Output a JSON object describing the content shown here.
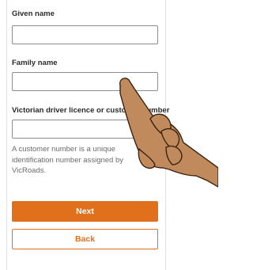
{
  "form": {
    "given_name_label": "Given name",
    "given_name_value": "",
    "family_name_label": "Family name",
    "family_name_value": "",
    "licence_label": "Victorian driver licence or customer number",
    "licence_value": "",
    "hint": "A customer number is a unique identification number assigned by VicRoads."
  },
  "actions": {
    "next_label": "Next",
    "back_label": "Back"
  },
  "colors": {
    "accent": "#e0701c",
    "hand_skin": "#c18a5c"
  },
  "icons": {
    "pointer": "pointing-hand-icon"
  }
}
